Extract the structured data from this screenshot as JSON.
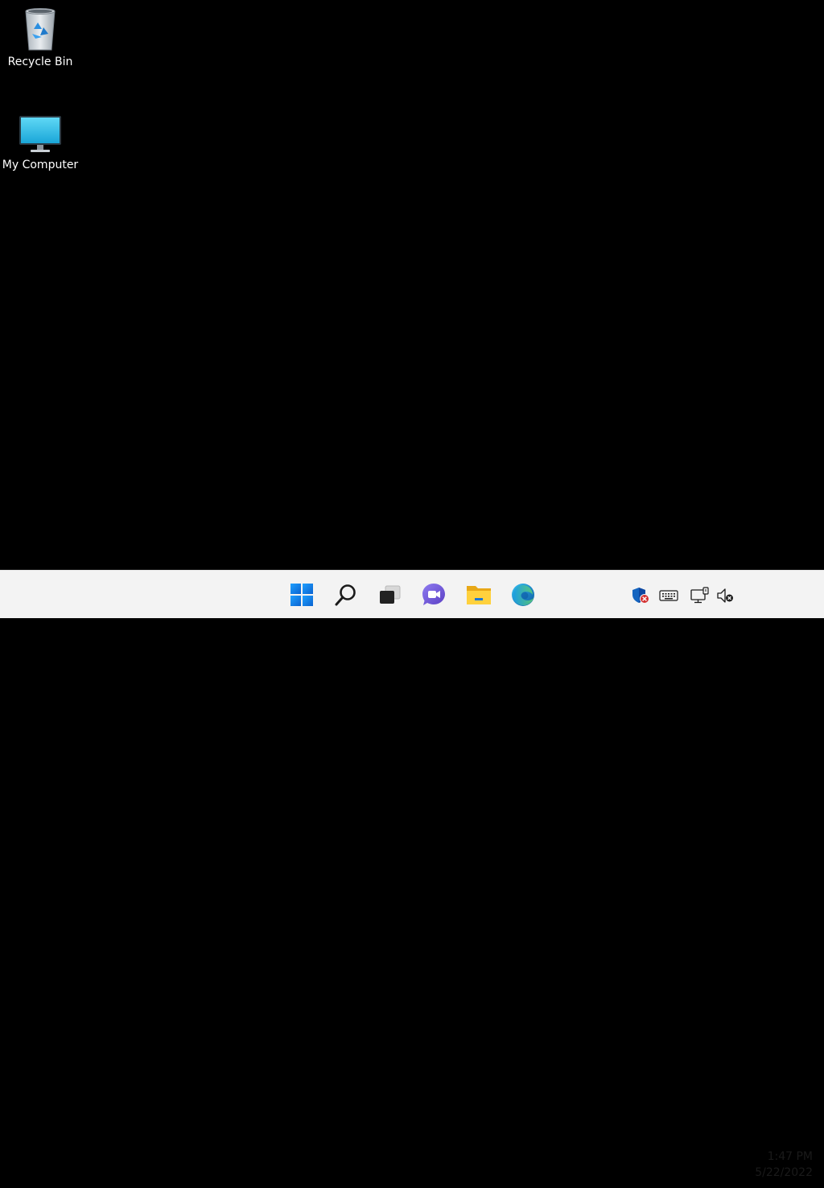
{
  "desktop": {
    "background": "#000000",
    "icons": [
      {
        "label": "Recycle Bin",
        "icon": "recycle-bin-icon"
      },
      {
        "label": "My Computer",
        "icon": "computer-monitor-icon"
      }
    ]
  },
  "taskbar": {
    "background": "#f3f3f3",
    "pinned": [
      {
        "icon": "windows-start-icon"
      },
      {
        "icon": "search-icon"
      },
      {
        "icon": "task-view-icon"
      },
      {
        "icon": "teams-chat-icon"
      },
      {
        "icon": "file-explorer-icon"
      },
      {
        "icon": "edge-browser-icon"
      }
    ],
    "tray": [
      {
        "icon": "security-shield-warning-icon"
      },
      {
        "icon": "keyboard-icon"
      },
      {
        "icon": "network-icon"
      },
      {
        "icon": "volume-muted-icon"
      }
    ],
    "clock": {
      "time": "1:47 PM",
      "date": "5/22/2022"
    }
  }
}
